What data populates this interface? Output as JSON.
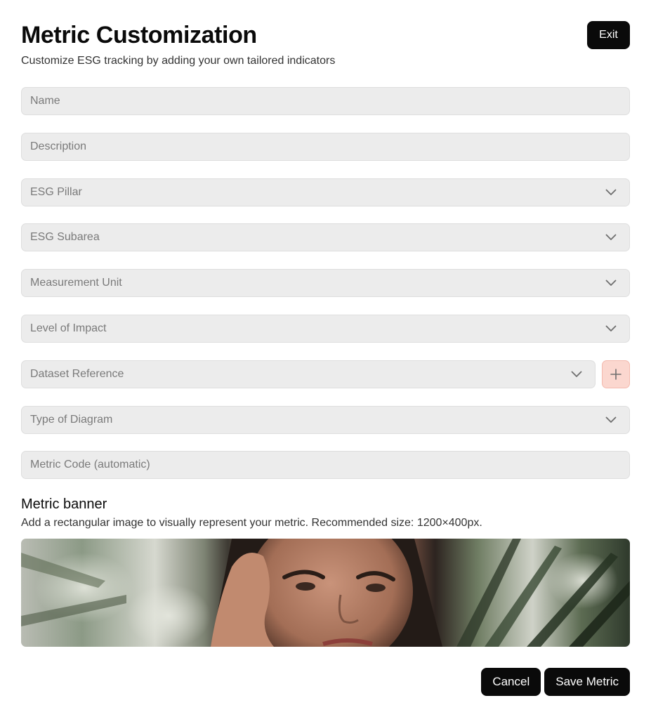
{
  "header": {
    "title": "Metric Customization",
    "subtitle": "Customize ESG tracking by adding your own tailored indicators",
    "exit_label": "Exit"
  },
  "fields": {
    "name": {
      "placeholder": "Name",
      "value": ""
    },
    "description": {
      "placeholder": "Description",
      "value": ""
    },
    "esg_pillar": {
      "placeholder": "ESG Pillar",
      "icon": "chevron-down-icon"
    },
    "esg_subarea": {
      "placeholder": "ESG Subarea",
      "icon": "chevron-down-icon"
    },
    "measurement_unit": {
      "placeholder": "Measurement Unit",
      "icon": "chevron-down-icon"
    },
    "level_of_impact": {
      "placeholder": "Level of Impact",
      "icon": "chevron-down-icon"
    },
    "dataset_reference": {
      "placeholder": "Dataset Reference",
      "icon": "chevron-down-icon",
      "add_icon": "plus-icon"
    },
    "type_of_diagram": {
      "placeholder": "Type of Diagram",
      "icon": "chevron-down-icon"
    },
    "metric_code": {
      "placeholder": "Metric Code (automatic)",
      "value": ""
    }
  },
  "banner": {
    "title": "Metric banner",
    "description": "Add a rectangular image to visually represent your metric. Recommended size: 1200×400px."
  },
  "footer": {
    "cancel_label": "Cancel",
    "save_label": "Save Metric"
  },
  "colors": {
    "primary": "#0a0a0a",
    "field_bg": "#ececec",
    "add_button_bg": "#fbd7cf"
  }
}
